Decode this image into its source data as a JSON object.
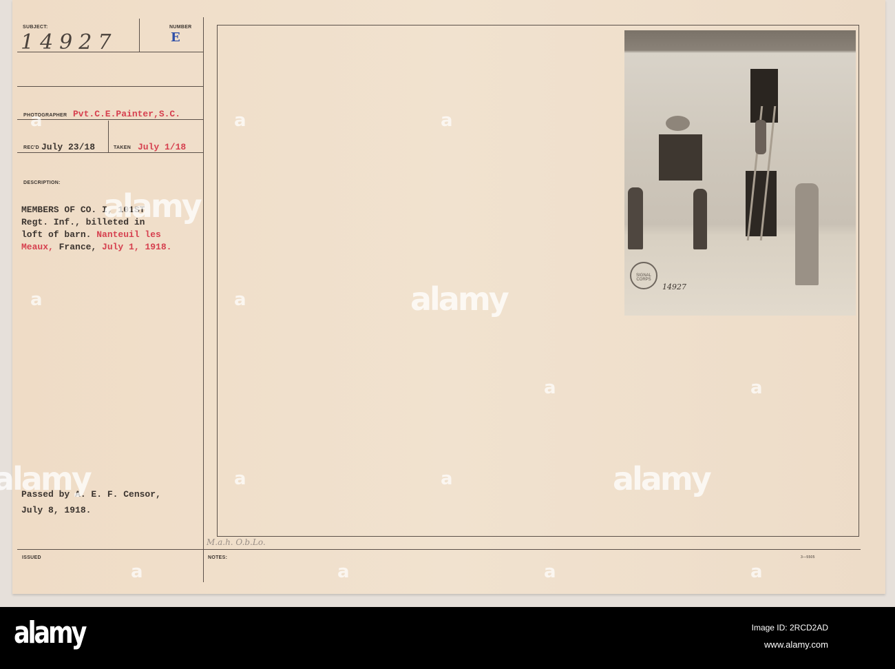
{
  "card": {
    "subject_label": "SUBJECT:",
    "subject_number": "14927",
    "number_label": "NUMBER",
    "number_value": "E",
    "photographer_label": "PHOTOGRAPHER",
    "photographer": "Pvt.C.E.Painter,S.C.",
    "recd_label": "REC'D",
    "recd_date": "July 23/18",
    "taken_label": "TAKEN",
    "taken_date": "July 1/18",
    "description_label": "DESCRIPTION:",
    "description_lines": [
      {
        "black": "MEMBERS OF CO. I, 101ST",
        "red": ""
      },
      {
        "black": "Regt. Inf., billeted in",
        "red": ""
      },
      {
        "black": "loft of barn. ",
        "red": "Nanteuil les"
      },
      {
        "red": "Meaux,",
        "black": " France, ",
        "red2": "July 1, 1918."
      }
    ],
    "censor_lines": [
      "Passed by A. E. F. Censor,",
      "July 8, 1918."
    ],
    "issued_label": "ISSUED",
    "notes_label": "NOTES:",
    "notes_handwritten": "M.a.h. O.b.Lo.",
    "form_number": "3—5505",
    "photo_stamp": "SIGNAL CORPS U.S.A.",
    "photo_number": "14927"
  },
  "colors": {
    "red_ink": "#d6404f",
    "blue_stamp": "#2f4fa8",
    "card": "#f0e0cc"
  },
  "watermark": "alamy",
  "footer": {
    "logo": "alamy",
    "image_id": "Image ID: 2RCD2AD",
    "url": "www.alamy.com"
  }
}
